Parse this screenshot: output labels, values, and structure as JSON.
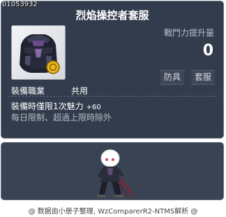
{
  "item": {
    "id": "01053932",
    "name": "烈焰操控者套服",
    "stat_label": "戰鬥力提升量",
    "stat_value": "0",
    "tags": [
      "防具",
      "套服"
    ],
    "job_label": "裝備職業",
    "job_value": "共用",
    "effect_text": "裝備時僅限1次魅力",
    "effect_bonus": "+60",
    "limit_text": "每日限制、超過上限時除外",
    "icon": "dark-armor-suit-icon"
  },
  "preview": {
    "character": "character-preview"
  },
  "footer": {
    "text": "@ 数据由小册子整理, WzComparerR2-NTMS解析 @"
  },
  "colors": {
    "panel_bg": "#333c4c",
    "border": "#6a7180",
    "text": "#ffffff",
    "muted": "#b9bfca"
  }
}
